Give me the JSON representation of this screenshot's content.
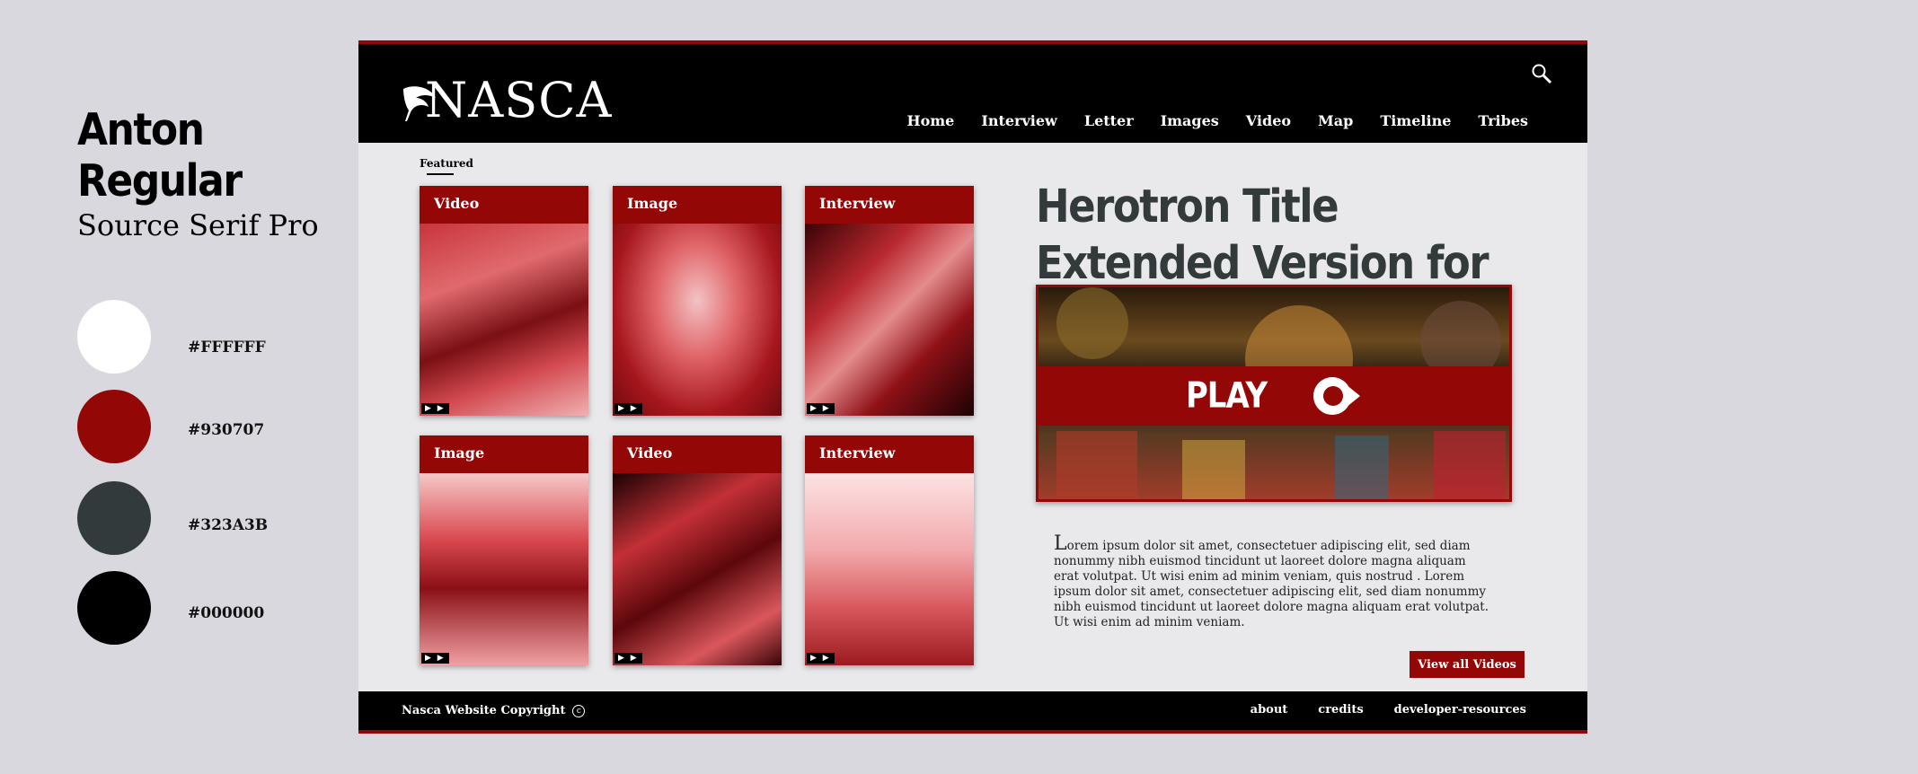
{
  "guide": {
    "font_display": "Anton Regular",
    "font_body": "Source Serif Pro",
    "swatches": [
      {
        "hex": "#FFFFFF"
      },
      {
        "hex": "#930707"
      },
      {
        "hex": "#323A3B"
      },
      {
        "hex": "#000000"
      }
    ]
  },
  "site": {
    "logo": "NASCA",
    "nav": [
      "Home",
      "Interview",
      "Letter",
      "Images",
      "Video",
      "Map",
      "Timeline",
      "Tribes"
    ],
    "featured_label": "Featured",
    "cards": [
      {
        "label": "Video"
      },
      {
        "label": "Image"
      },
      {
        "label": "Interview"
      },
      {
        "label": "Image"
      },
      {
        "label": "Video"
      },
      {
        "label": "Interview"
      }
    ],
    "card_badge": "▶ ▶",
    "hero_title": "Herotron Title Extended Version for Experiment.",
    "play_label": "PLAY",
    "body_text": "Lorem ipsum dolor sit amet, consectetuer adipiscing elit, sed diam nonummy nibh euismod tincidunt ut laoreet dolore magna aliquam erat volutpat. Ut wisi enim ad minim veniam, quis nostrud . Lorem ipsum dolor sit amet, consectetuer adipiscing elit, sed diam nonummy nibh euismod tincidunt ut laoreet dolore magna aliquam erat volutpat. Ut wisi enim ad minim veniam.",
    "view_all_label": "View all Videos",
    "copyright": "Nasca Website Copyright",
    "copyright_symbol": "c",
    "footer_links": [
      "about",
      "credits",
      "developer-resources"
    ]
  },
  "colors": {
    "accent": "#930707",
    "dark": "#323A3B",
    "black": "#000000",
    "white": "#FFFFFF"
  }
}
